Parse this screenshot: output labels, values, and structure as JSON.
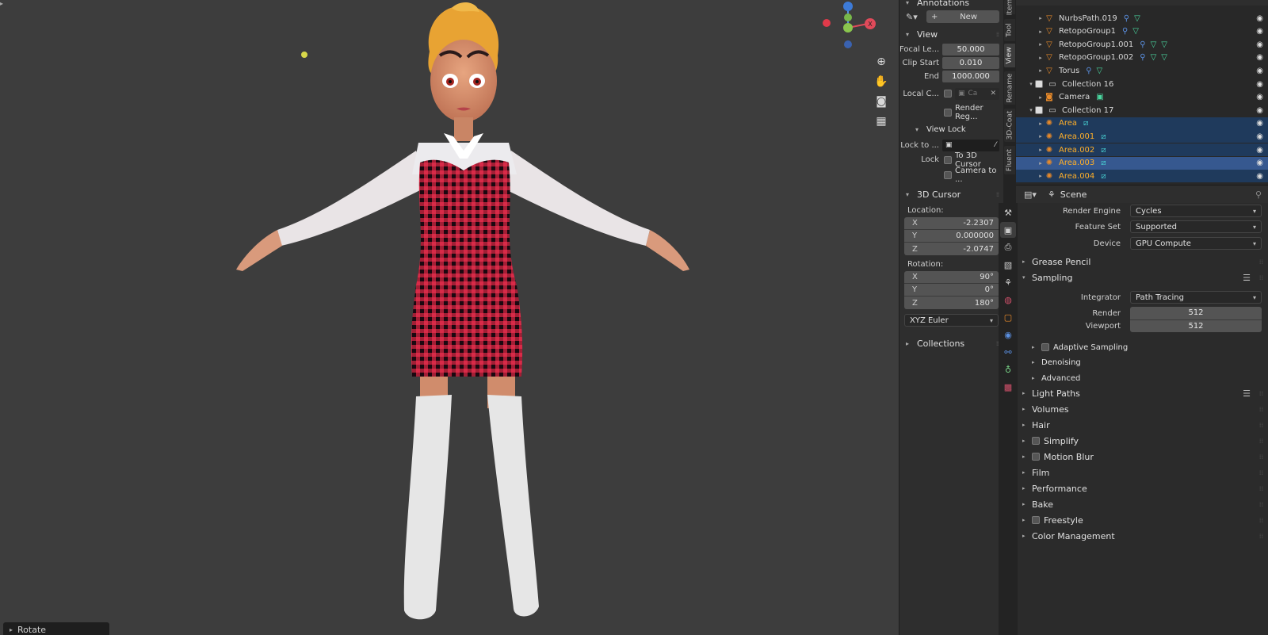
{
  "viewport": {
    "operator_panel_label": "Rotate",
    "gizmo_axes": {
      "x": "X",
      "y": "Y",
      "z": "Z"
    }
  },
  "npanel": {
    "annotations": {
      "label": "Annotations",
      "new_label": "New"
    },
    "view": {
      "title": "View",
      "focal_length_label": "Focal Le...",
      "focal_length_value": "50.000",
      "clip_start_label": "Clip Start",
      "clip_start_value": "0.010",
      "clip_end_label": "End",
      "clip_end_value": "1000.000",
      "local_camera_label": "Local C...",
      "local_camera_placeholder": "Ca",
      "render_region_label": "Render Reg...",
      "view_lock_title": "View Lock",
      "lock_to_label": "Lock to ...",
      "lock_label": "Lock",
      "to_3d_cursor_label": "To 3D Cursor",
      "camera_to_label": "Camera to ..."
    },
    "cursor": {
      "title": "3D Cursor",
      "location_label": "Location:",
      "location": [
        {
          "axis": "X",
          "value": "-2.2307"
        },
        {
          "axis": "Y",
          "value": "0.000000"
        },
        {
          "axis": "Z",
          "value": "-2.0747"
        }
      ],
      "rotation_label": "Rotation:",
      "rotation": [
        {
          "axis": "X",
          "value": "90°"
        },
        {
          "axis": "Y",
          "value": "0°"
        },
        {
          "axis": "Z",
          "value": "180°"
        }
      ],
      "rotation_mode": "XYZ Euler"
    },
    "collections_title": "Collections"
  },
  "vtabs": [
    "Item",
    "Tool",
    "View",
    "Rename",
    "3D-Coat",
    "Fluent"
  ],
  "outliner": {
    "rows": [
      {
        "name": "NurbsPath.019",
        "indent": 2,
        "type": "mesh",
        "mods": 2
      },
      {
        "name": "RetopoGroup1",
        "indent": 2,
        "type": "mesh",
        "mods": 2
      },
      {
        "name": "RetopoGroup1.001",
        "indent": 2,
        "type": "mesh",
        "mods": 3
      },
      {
        "name": "RetopoGroup1.002",
        "indent": 2,
        "type": "mesh",
        "mods": 3
      },
      {
        "name": "Torus",
        "indent": 2,
        "type": "mesh",
        "mods": 2
      },
      {
        "name": "Collection 16",
        "indent": 1,
        "type": "collection",
        "mods": 0
      },
      {
        "name": "Camera",
        "indent": 2,
        "type": "camera",
        "mods": 1
      },
      {
        "name": "Collection 17",
        "indent": 1,
        "type": "collection",
        "mods": 0
      },
      {
        "name": "Area",
        "indent": 2,
        "type": "light",
        "mods": 1,
        "selected": true
      },
      {
        "name": "Area.001",
        "indent": 2,
        "type": "light",
        "mods": 1,
        "selected": true
      },
      {
        "name": "Area.002",
        "indent": 2,
        "type": "light",
        "mods": 1,
        "selected": true
      },
      {
        "name": "Area.003",
        "indent": 2,
        "type": "light",
        "mods": 1,
        "selected": true,
        "active": true
      },
      {
        "name": "Area.004",
        "indent": 2,
        "type": "light",
        "mods": 1,
        "selected": true
      }
    ]
  },
  "properties": {
    "context": "Scene",
    "render_engine_label": "Render Engine",
    "render_engine": "Cycles",
    "feature_set_label": "Feature Set",
    "feature_set": "Supported",
    "device_label": "Device",
    "device": "GPU Compute",
    "grease_pencil": "Grease Pencil",
    "sampling": "Sampling",
    "integrator_label": "Integrator",
    "integrator": "Path Tracing",
    "render_label": "Render",
    "render_samples": "512",
    "viewport_label": "Viewport",
    "viewport_samples": "512",
    "adaptive_sampling": "Adaptive Sampling",
    "denoising": "Denoising",
    "advanced": "Advanced",
    "light_paths": "Light Paths",
    "volumes": "Volumes",
    "hair": "Hair",
    "simplify": "Simplify",
    "motion_blur": "Motion Blur",
    "film": "Film",
    "performance": "Performance",
    "bake": "Bake",
    "freestyle": "Freestyle",
    "color_management": "Color Management"
  }
}
